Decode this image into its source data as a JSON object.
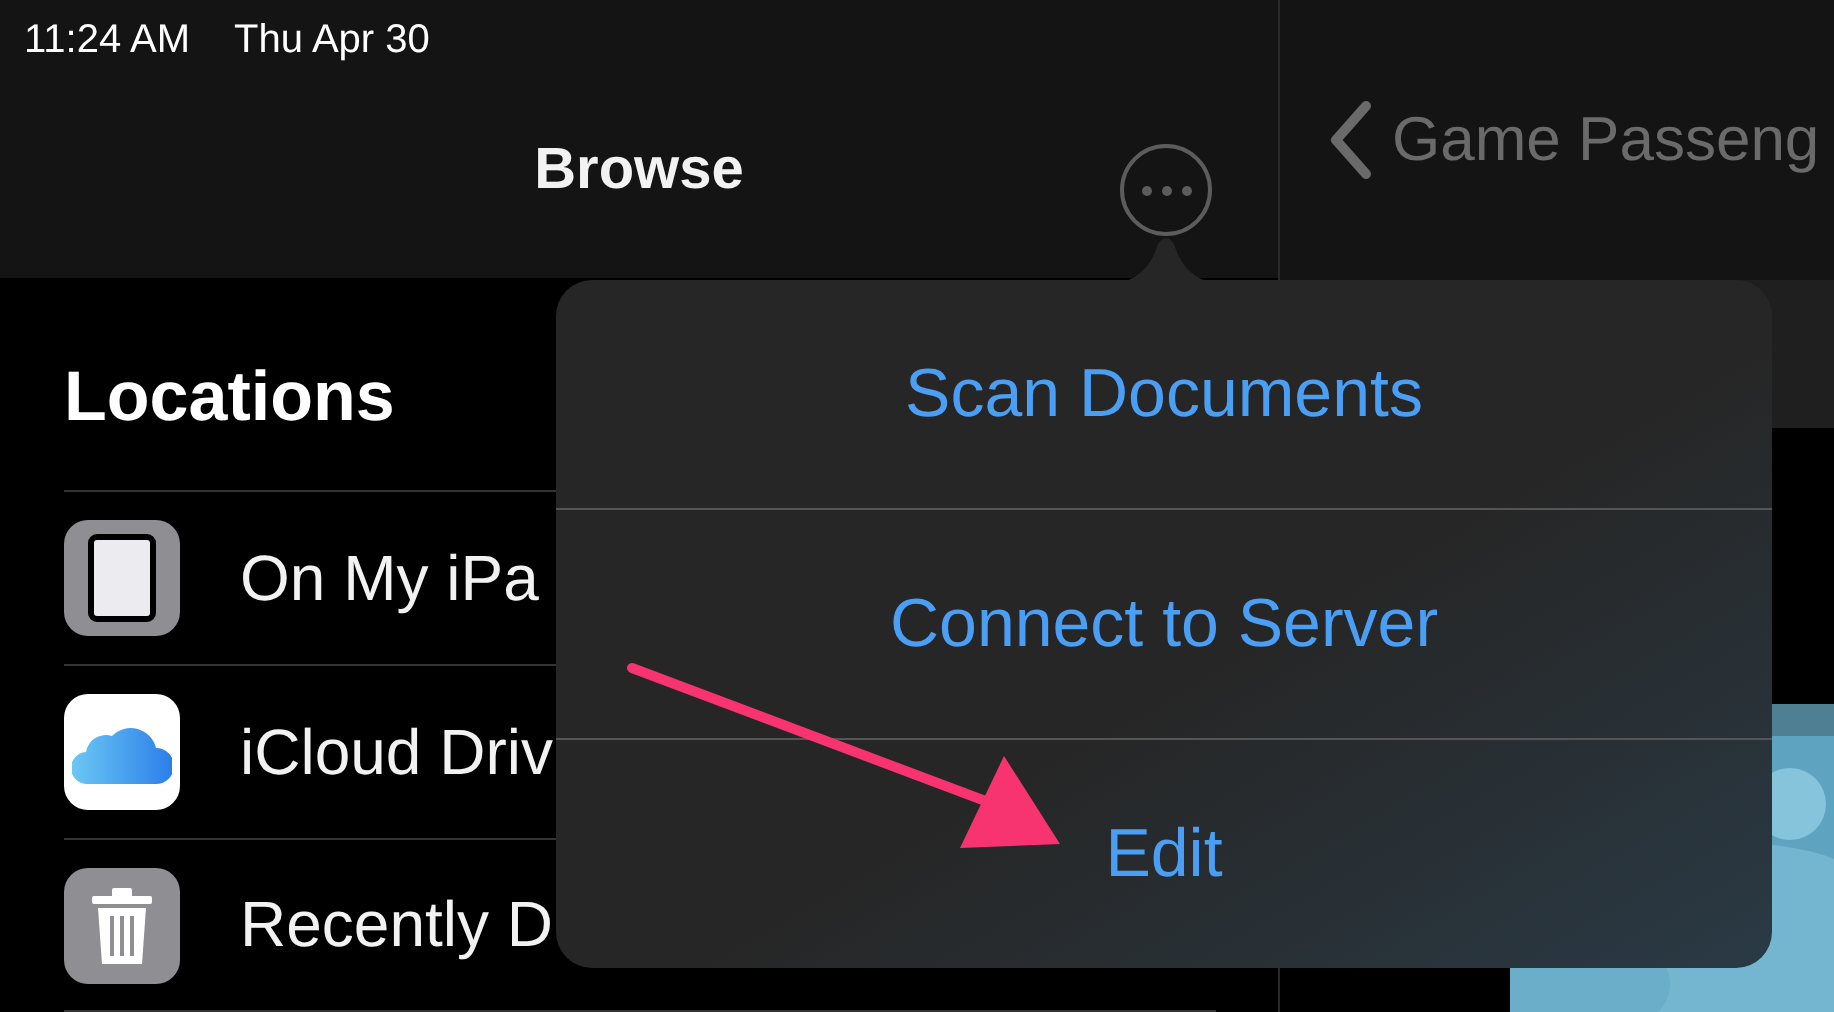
{
  "status_bar": {
    "time": "11:24 AM",
    "date": "Thu Apr 30"
  },
  "browse": {
    "title": "Browse",
    "section_title": "Locations",
    "locations": [
      {
        "kind": "ipad",
        "label": "On My iPa"
      },
      {
        "kind": "cloud",
        "label": "iCloud Driv"
      },
      {
        "kind": "trash",
        "label": "Recently D"
      }
    ]
  },
  "detail": {
    "back_label": "Game Passeng"
  },
  "menu": {
    "items": [
      "Scan Documents",
      "Connect to Server",
      "Edit"
    ]
  }
}
